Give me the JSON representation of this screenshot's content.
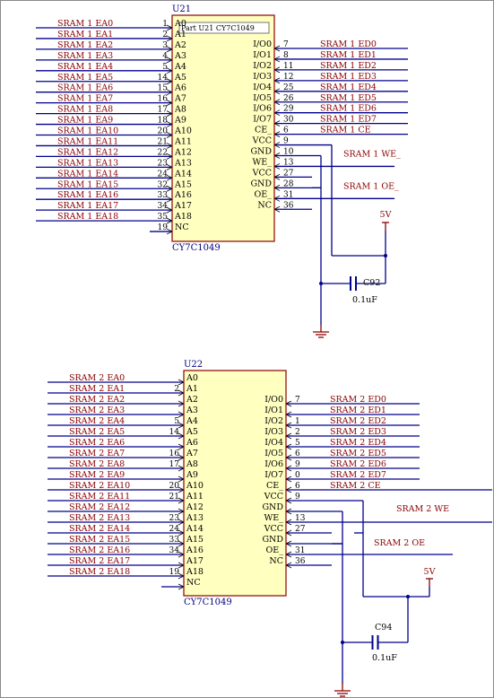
{
  "colors": {
    "wire": "#00008b",
    "net_label": "#8b0000",
    "chip_fill": "#ffffc0",
    "chip_border": "#8b0000",
    "pin_text": "#000000",
    "designator": "#000080",
    "power": "#8b0000"
  },
  "u21": {
    "designator": "U21",
    "part_tag": "Part U21 CY7C1049",
    "part_name": "CY7C1049",
    "left_nets": [
      "SRAM 1 EA0",
      "SRAM 1 EA1",
      "SRAM 1 EA2",
      "SRAM 1 EA3",
      "SRAM 1 EA4",
      "SRAM 1 EA5",
      "SRAM 1 EA6",
      "SRAM 1 EA7",
      "SRAM 1 EA8",
      "SRAM 1 EA9",
      "SRAM 1 EA10",
      "SRAM 1 EA11",
      "SRAM 1 EA12",
      "SRAM 1 EA13",
      "SRAM 1 EA14",
      "SRAM 1 EA15",
      "SRAM 1 EA16",
      "SRAM 1 EA17",
      "SRAM 1 EA18"
    ],
    "left_nums": [
      "1",
      "2",
      "3",
      "4",
      "5",
      "14",
      "15",
      "16",
      "17",
      "18",
      "20",
      "21",
      "22",
      "23",
      "24",
      "32",
      "33",
      "34",
      "35",
      "19"
    ],
    "right_nets": [
      "SRAM 1 ED0",
      "SRAM 1 ED1",
      "SRAM 1 ED2",
      "SRAM 1 ED3",
      "SRAM 1 ED4",
      "SRAM 1 ED5",
      "SRAM 1 ED6",
      "SRAM 1 ED7",
      "SRAM 1 CE",
      "",
      "",
      "SRAM 1 WE_",
      "",
      "",
      "SRAM 1 OE_",
      ""
    ],
    "right_nums": [
      "7",
      "8",
      "11",
      "12",
      "25",
      "26",
      "29",
      "30",
      "6",
      "9",
      "10",
      "13",
      "27",
      "28",
      "31",
      "36"
    ],
    "cap": "C92",
    "cap_value": "0.1uF",
    "supply": "5V"
  },
  "u22": {
    "designator": "U22",
    "part_name": "CY7C1049",
    "left_nets": [
      "SRAM 2 EA0",
      "SRAM 2 EA1",
      "SRAM 2 EA2",
      "SRAM 2 EA3",
      "SRAM 2 EA4",
      "SRAM 2 EA5",
      "SRAM 2 EA6",
      "SRAM 2 EA7",
      "SRAM 2 EA8",
      "SRAM 2 EA9",
      "SRAM 2 EA10",
      "SRAM 2 EA11",
      "SRAM 2 EA12",
      "SRAM 2 EA13",
      "SRAM 2 EA14",
      "SRAM 2 EA15",
      "SRAM 2 EA16",
      "SRAM 2 EA17",
      "SRAM 2 EA18"
    ],
    "left_nums": [
      "",
      "2",
      "",
      "",
      "5",
      "14",
      "",
      "16",
      "17",
      "",
      "20",
      "21",
      "",
      "23",
      "24",
      "33",
      "34",
      "",
      "19",
      ""
    ],
    "right_nets": [
      "SRAM 2 ED0",
      "SRAM 2 ED1",
      "SRAM 2 ED2",
      "SRAM 2 ED3",
      "SRAM 2 ED4",
      "SRAM 2 ED5",
      "SRAM 2 ED6",
      "SRAM 2 ED7",
      "SRAM 2 CE",
      "",
      "",
      "SRAM 2 WE",
      "",
      "",
      "SRAM 2 OE",
      ""
    ],
    "right_nums": [
      "7",
      "",
      "1",
      "2",
      "5",
      "6",
      "9",
      "0",
      "6",
      "9",
      "",
      "13",
      "27",
      "",
      "31",
      "36"
    ],
    "cap": "C94",
    "cap_value": "0.1uF",
    "supply": "5V"
  },
  "pins_left": [
    "A0",
    "A1",
    "A2",
    "A3",
    "A4",
    "A5",
    "A6",
    "A7",
    "A8",
    "A9",
    "A10",
    "A11",
    "A12",
    "A13",
    "A14",
    "A15",
    "A16",
    "A17",
    "A18",
    "NC"
  ],
  "pins_right": [
    "I/O0",
    "I/O1",
    "I/O2",
    "I/O3",
    "I/O4",
    "I/O5",
    "I/O6",
    "I/O7",
    "CE_",
    "VCC",
    "GND",
    "WE_",
    "VCC",
    "GND",
    "OE_",
    "NC"
  ]
}
